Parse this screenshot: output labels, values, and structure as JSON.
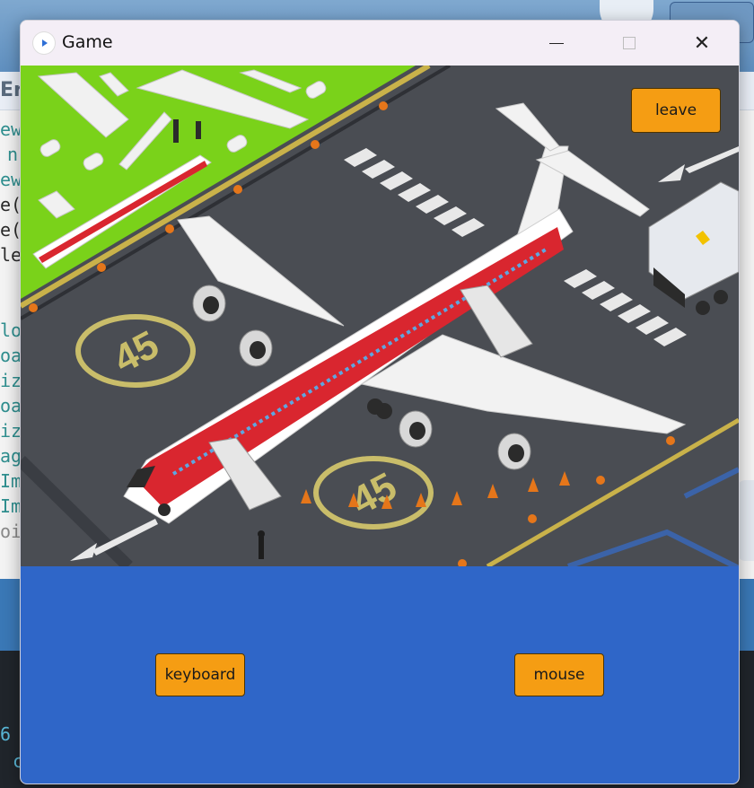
{
  "window": {
    "title": "Game",
    "icon": "play-icon",
    "controls": {
      "minimize": "minimize-icon",
      "maximize": "maximize-icon",
      "close": "close-icon"
    }
  },
  "scene": {
    "description_icon": "airport-illustration",
    "buttons": {
      "leave_label": "leave"
    },
    "marking_text": [
      "45",
      "45"
    ]
  },
  "controls": {
    "keyboard_label": "keyboard",
    "mouse_label": "mouse"
  },
  "colors": {
    "panel_background": "#2f66c8",
    "button_background": "#f59d13",
    "titlebar_background": "#f4eef6"
  },
  "background_app": {
    "tab_label": "Er",
    "code_fragments": [
      "ew",
      "n",
      "ew",
      "e(",
      "e(",
      "le",
      "lo",
      "oa",
      "iz",
      "oa",
      "iz",
      "ag",
      "Im",
      "Im",
      "oi"
    ],
    "terminal_fragments": [
      "6",
      "c"
    ]
  }
}
